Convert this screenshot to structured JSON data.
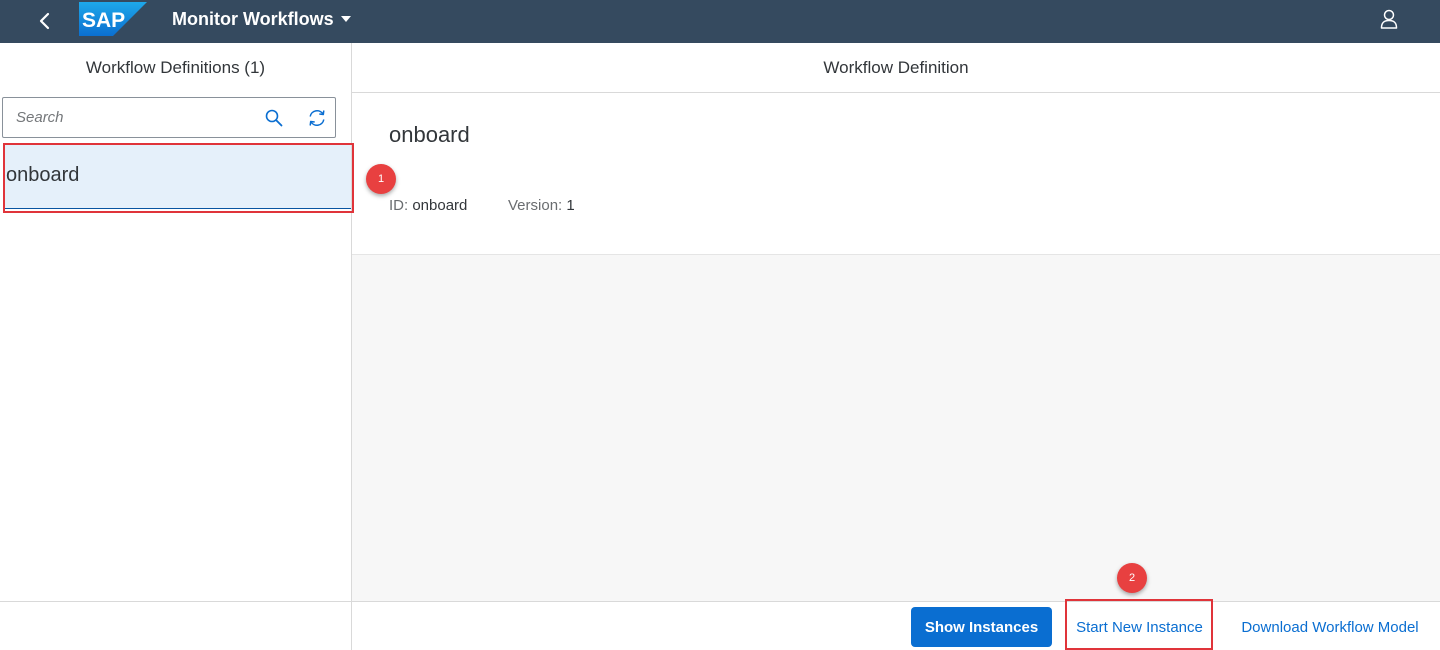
{
  "shell": {
    "logo_text": "SAP",
    "app_title": "Monitor Workflows",
    "colors": {
      "shell_bg": "#354a5f",
      "logo_gradient_top": "#1ea8ea",
      "logo_gradient_bottom": "#0b6fd0"
    },
    "icons": {
      "back": "chevron-left-icon",
      "menu": "caret-down-icon",
      "user": "person-icon"
    }
  },
  "master": {
    "title": "Workflow Definitions (1)",
    "search": {
      "placeholder": "Search",
      "value": ""
    },
    "icons": {
      "search": "search-icon",
      "refresh": "refresh-icon"
    },
    "items": [
      {
        "label": "onboard",
        "selected": true
      }
    ]
  },
  "detail": {
    "title": "Workflow Definition",
    "object": {
      "title": "onboard",
      "id_label": "ID:",
      "id_value": "onboard",
      "version_label": "Version:",
      "version_value": "1"
    },
    "footer": {
      "show_instances": "Show Instances",
      "start_new_instance": "Start New Instance",
      "download_model": "Download Workflow Model"
    }
  },
  "annotations": {
    "marker_1": "1",
    "marker_2": "2",
    "highlight_color": "#e0343a"
  }
}
